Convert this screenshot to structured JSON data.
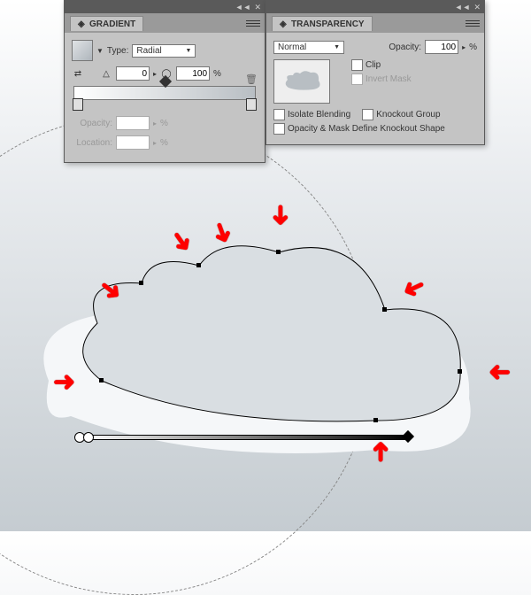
{
  "gradient": {
    "title": "GRADIENT",
    "typeLabel": "Type:",
    "typeValue": "Radial",
    "angleValue": "0",
    "aspectValue": "100",
    "pct": "%",
    "opacityLabel": "Opacity:",
    "opacityUnit": "%",
    "locationLabel": "Location:",
    "locationUnit": "%",
    "titlebar": {
      "collapse": "◄◄",
      "close": "✕"
    }
  },
  "transparency": {
    "title": "TRANSPARENCY",
    "blendMode": "Normal",
    "opacityLabel": "Opacity:",
    "opacityValue": "100",
    "pct": "%",
    "clip": "Clip",
    "invert": "Invert Mask",
    "isolate": "Isolate Blending",
    "knockout": "Knockout Group",
    "define": "Opacity & Mask Define Knockout Shape",
    "titlebar": {
      "collapse": "◄◄",
      "close": "✕"
    }
  }
}
